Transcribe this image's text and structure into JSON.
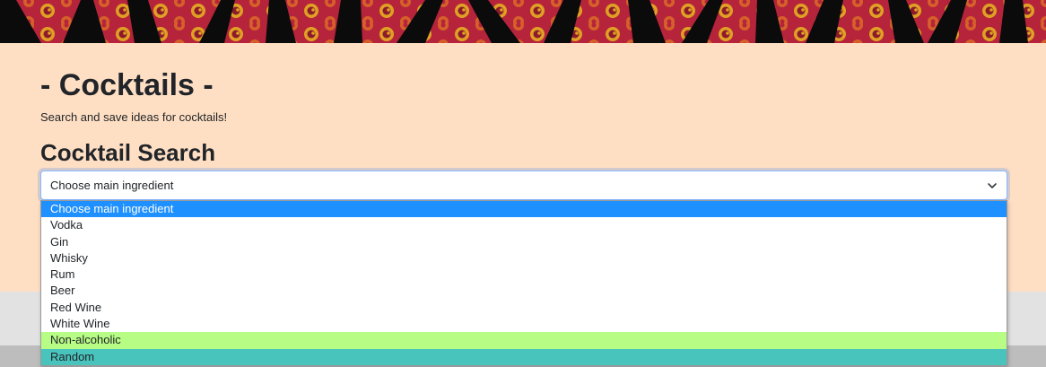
{
  "page": {
    "title": "- Cocktails -",
    "subtitle": "Search and save ideas for cocktails!",
    "section_title": "Cocktail Search"
  },
  "search": {
    "selected": "Choose main ingredient",
    "options": [
      "Choose main ingredient",
      "Vodka",
      "Gin",
      "Whisky",
      "Rum",
      "Beer",
      "Red Wine",
      "White Wine",
      "Non-alcoholic",
      "Random"
    ]
  },
  "colors": {
    "hero_background": "#ffdfc3",
    "highlight_option": "#1e90ff",
    "non_alcoholic_option": "#b7fd85",
    "random_option": "#49c4bd",
    "banner_red": "#b5243a",
    "banner_gold": "#e0a024"
  },
  "icons": {
    "select_arrow": "chevron-down-icon"
  }
}
